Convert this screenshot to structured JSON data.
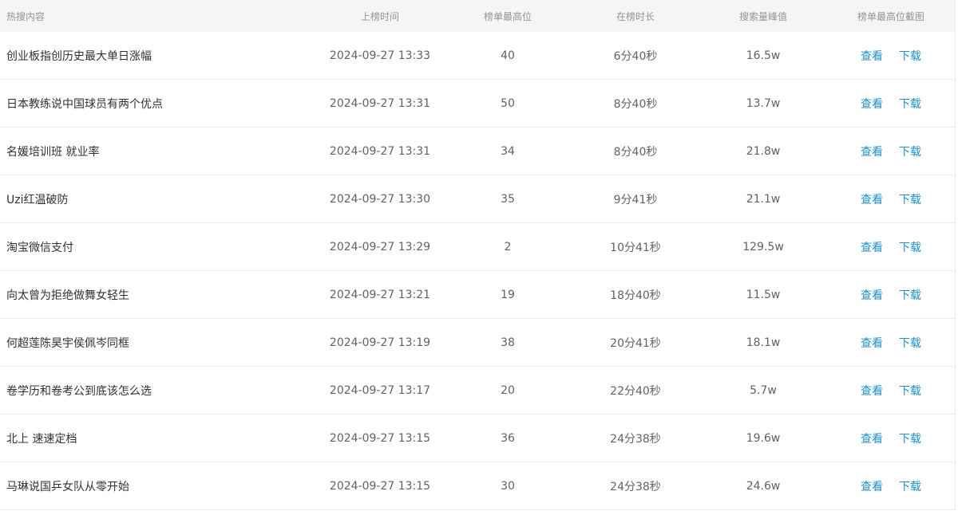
{
  "table": {
    "headers": {
      "title": "热搜内容",
      "time": "上榜时间",
      "rank": "榜单最高位",
      "duration": "在榜时长",
      "peak": "搜索量峰值",
      "screenshot": "榜单最高位截图"
    },
    "rows": [
      {
        "title": "创业板指创历史最大单日涨幅",
        "time": "2024-09-27 13:33",
        "rank": "40",
        "duration": "6分40秒",
        "peak": "16.5w",
        "view": "查看",
        "download": "下载"
      },
      {
        "title": "日本教练说中国球员有两个优点",
        "time": "2024-09-27 13:31",
        "rank": "50",
        "duration": "8分40秒",
        "peak": "13.7w",
        "view": "查看",
        "download": "下载"
      },
      {
        "title": "名媛培训班 就业率",
        "time": "2024-09-27 13:31",
        "rank": "34",
        "duration": "8分40秒",
        "peak": "21.8w",
        "view": "查看",
        "download": "下载"
      },
      {
        "title": "Uzi红温破防",
        "time": "2024-09-27 13:30",
        "rank": "35",
        "duration": "9分41秒",
        "peak": "21.1w",
        "view": "查看",
        "download": "下载"
      },
      {
        "title": "淘宝微信支付",
        "time": "2024-09-27 13:29",
        "rank": "2",
        "duration": "10分41秒",
        "peak": "129.5w",
        "view": "查看",
        "download": "下载"
      },
      {
        "title": "向太曾为拒绝做舞女轻生",
        "time": "2024-09-27 13:21",
        "rank": "19",
        "duration": "18分40秒",
        "peak": "11.5w",
        "view": "查看",
        "download": "下载"
      },
      {
        "title": "何超莲陈昊宇侯佩岑同框",
        "time": "2024-09-27 13:19",
        "rank": "38",
        "duration": "20分41秒",
        "peak": "18.1w",
        "view": "查看",
        "download": "下载"
      },
      {
        "title": "卷学历和卷考公到底该怎么选",
        "time": "2024-09-27 13:17",
        "rank": "20",
        "duration": "22分40秒",
        "peak": "5.7w",
        "view": "查看",
        "download": "下载"
      },
      {
        "title": "北上 速速定档",
        "time": "2024-09-27 13:15",
        "rank": "36",
        "duration": "24分38秒",
        "peak": "19.6w",
        "view": "查看",
        "download": "下载"
      },
      {
        "title": "马琳说国乒女队从零开始",
        "time": "2024-09-27 13:15",
        "rank": "30",
        "duration": "24分38秒",
        "peak": "24.6w",
        "view": "查看",
        "download": "下载"
      }
    ]
  },
  "colors": {
    "header_bg": "#f5f5f5",
    "header_text": "#909399",
    "body_text": "#606266",
    "link": "#2a8fcc",
    "border": "#ebeef5"
  }
}
